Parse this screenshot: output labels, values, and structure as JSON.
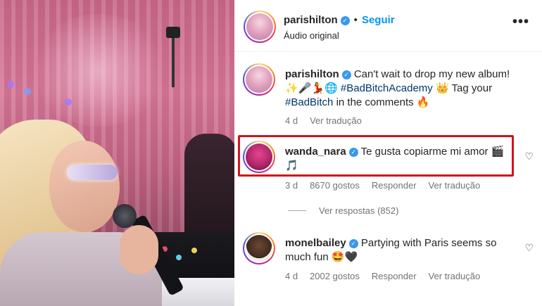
{
  "colors": {
    "link_blue": "#0095f6",
    "verified_blue": "#3897f0",
    "hashtag": "#00376b",
    "meta_gray": "#737373",
    "highlight_red": "#d0141c"
  },
  "media": {
    "icon": "video-frame"
  },
  "header": {
    "username": "parishilton",
    "separator": "•",
    "follow_label": "Seguir",
    "subtitle": "Áudio original",
    "more_icon": "•••"
  },
  "comments": [
    {
      "username": "parishilton",
      "text_before": "Can't wait to drop my new album! ✨🎤💃🌐",
      "tag1": "#BadBitchAcademy",
      "text_middle": "👑 Tag your",
      "tag2": "#BadBitch",
      "text_after": "in the comments 🔥",
      "time": "4 d",
      "translate": "Ver tradução"
    },
    {
      "username": "wanda_nara",
      "text": "Te gusta copiarme mi amor 🎬🎵",
      "time": "3 d",
      "likes": "8670 gostos",
      "reply": "Responder",
      "translate": "Ver tradução",
      "view_replies": "Ver respostas (852)"
    },
    {
      "username": "monelbailey",
      "text": "Partying with Paris seems so much fun 🤩🖤",
      "time": "4 d",
      "likes": "2002 gostos",
      "reply": "Responder",
      "translate": "Ver tradução"
    }
  ],
  "icons": {
    "verified": "✓",
    "heart": "♡"
  }
}
